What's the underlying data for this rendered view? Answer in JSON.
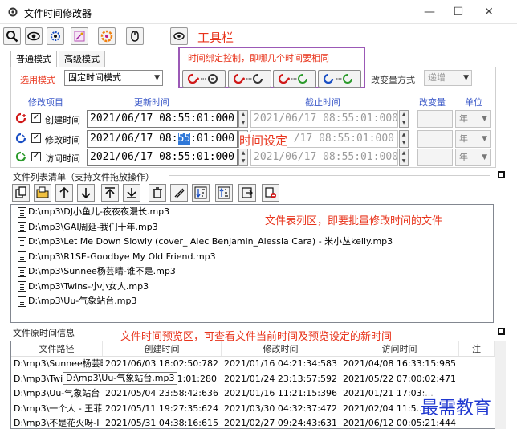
{
  "window": {
    "title": "文件时间修改器",
    "minimize": "—",
    "maximize": "☐",
    "close": "✕"
  },
  "toolbar": {
    "annotation": "工具栏",
    "icons": [
      "zoom-icon",
      "eye-icon",
      "gear-icon",
      "magic-icon",
      "color-icon",
      "mouse-icon",
      "eye-small-icon"
    ]
  },
  "tabs": [
    {
      "label": "普通模式",
      "active": true
    },
    {
      "label": "高级模式",
      "active": false
    }
  ],
  "binding": {
    "annotation": "时间绑定控制，即哪几个时间要相同",
    "buttons": [
      "bind-create-modify-icon",
      "bind-create-access-icon",
      "bind-modify-create-icon",
      "bind-modify-access-icon"
    ]
  },
  "mode": {
    "label": "选用模式",
    "value": "固定时间模式",
    "change_label": "改变量方式",
    "change_value": "递增"
  },
  "columns": {
    "item": "修改项目",
    "update": "更新时间",
    "end": "截止时间",
    "delta": "改变量",
    "unit": "单位"
  },
  "rows": [
    {
      "label": "创建时间",
      "checked": "✓",
      "update": "2021/06/17 08:55:01:000",
      "end": "2021/06/17 08:55:01:000",
      "unit": "年"
    },
    {
      "label": "修改时间",
      "checked": "✓",
      "update_pre": "2021/06/17 08:",
      "update_sel": "55",
      "update_post": ":01:000",
      "end": "/17 08:55:01:000",
      "unit": "年"
    },
    {
      "label": "访问时间",
      "checked": "✓",
      "update": "2021/06/17 08:55:01:000",
      "end": "2021/06/17 08:55:01:000",
      "unit": "年"
    }
  ],
  "time_setting_annotation": "时间设定",
  "file_list": {
    "title": "文件列表清单（支持文件拖放操作）",
    "annotation": "文件表列区，即要批量修改时间的文件",
    "items": [
      "D:\\mp3\\DJ小鱼儿-夜夜夜漫长.mp3",
      "D:\\mp3\\GAI周延-我们十年.mp3",
      "D:\\mp3\\Let Me Down Slowly (cover_ Alec Benjamin_Alessia Cara) - 米小丛kelly.mp3",
      "D:\\mp3\\R1SE-Goodbye My Old Friend.mp3",
      "D:\\mp3\\Sunnee杨芸晴-谁不是.mp3",
      "D:\\mp3\\Twins-小小女人.mp3",
      "D:\\mp3\\Uu-气象站台.mp3"
    ]
  },
  "preview": {
    "title": "文件原时间信息",
    "annotation": "文件时间预览区，可查看文件当前时间及预览设定的新时间",
    "headers": [
      "文件路径",
      "创建时间",
      "修改时间",
      "访问时间",
      "注"
    ],
    "rows": [
      [
        "D:\\mp3\\Sunnee杨芸晴",
        "2021/06/03 18:02:50:782",
        "2021/01/16 04:21:34:583",
        "2021/04/08 16:33:15:985"
      ],
      [
        "D:\\mp3\\Twi",
        "...41:01:280",
        "2021/01/24 23:13:57:592",
        "2021/05/22 07:00:02:471"
      ],
      [
        "D:\\mp3\\Uu-气象站台",
        "2021/05/04 23:58:42:636",
        "2021/01/16 11:21:15:396",
        "2021/01/21 17:03:..."
      ],
      [
        "D:\\mp3\\一个人 - 王菲",
        "2021/05/11 19:27:35:624",
        "2021/03/30 04:32:37:472",
        "2021/02/04 11:5..."
      ],
      [
        "D:\\mp3\\不是花火呀-I",
        "2021/05/31 04:38:16:615",
        "2021/02/27 09:24:43:631",
        "2021/06/12 00:05:21:444"
      ]
    ],
    "tooltip": "D:\\mp3\\Uu-气象站台.mp3"
  },
  "watermark": "最需教育",
  "colors": {
    "accent_red": "#e8341c",
    "heading_blue": "#3a58c8",
    "frame_purple": "#9b59b6"
  }
}
